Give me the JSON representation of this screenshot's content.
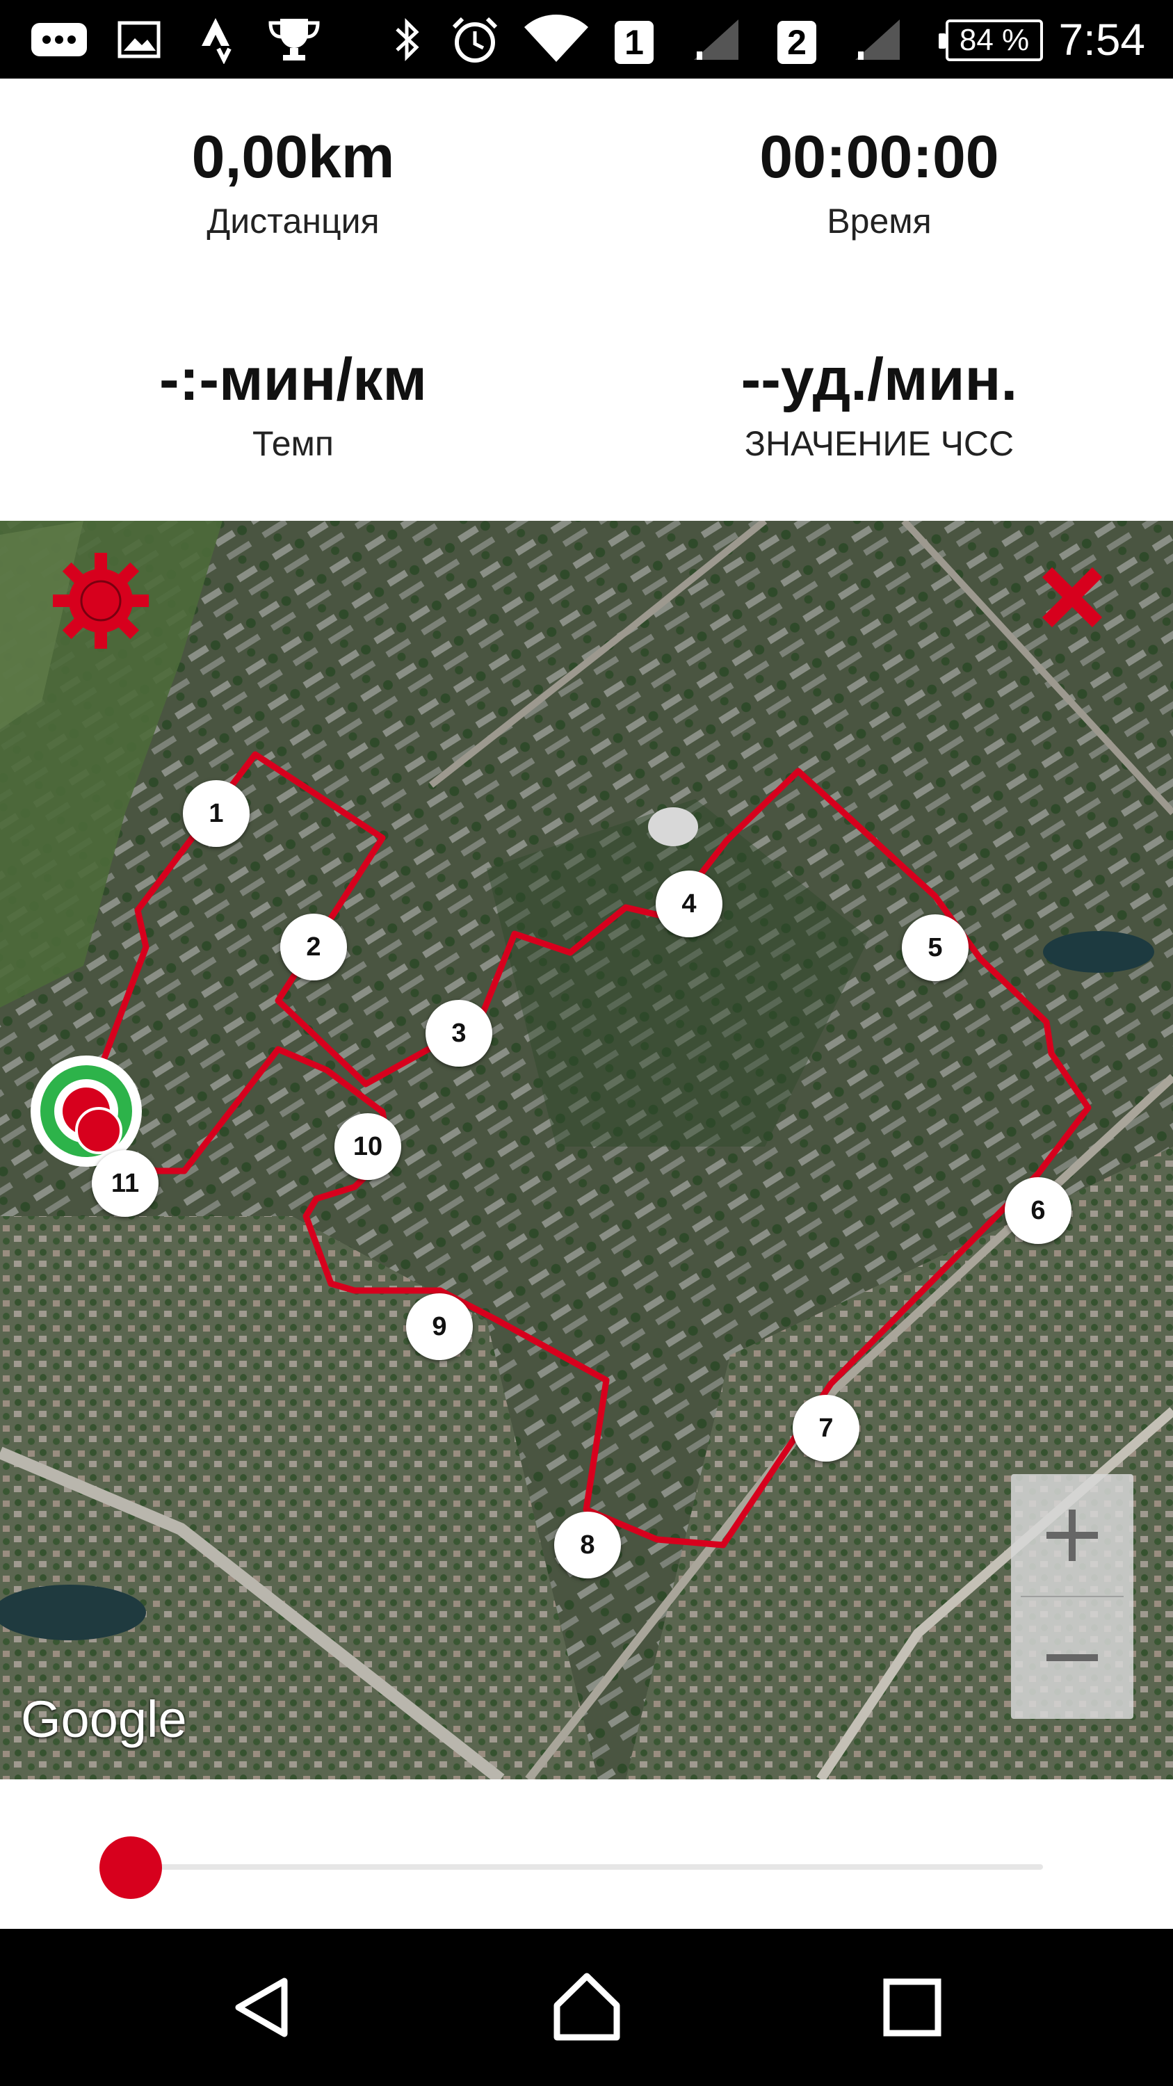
{
  "status_bar": {
    "time": "7:54",
    "battery": "84 %",
    "sim1": "1",
    "sim2": "2",
    "icons": [
      "more-notifications-icon",
      "gallery-icon",
      "strava-icon",
      "trophy-icon",
      "bluetooth-icon",
      "alarm-icon",
      "wifi-icon",
      "signal-icon",
      "battery-icon"
    ]
  },
  "stats": {
    "distance": {
      "value": "0,00km",
      "label": "Дистанция"
    },
    "time": {
      "value": "00:00:00",
      "label": "Время"
    },
    "pace": {
      "value": "-:-мин/км",
      "label": "Темп"
    },
    "heart_rate": {
      "value": "--уд./мин.",
      "label": "ЗНАЧЕНИЕ ЧСС"
    }
  },
  "map": {
    "attribution": "Google",
    "route_color": "#d7001d",
    "markers": [
      "1",
      "2",
      "3",
      "4",
      "5",
      "6",
      "7",
      "8",
      "9",
      "10",
      "11"
    ],
    "zoom_in": "+",
    "zoom_out": "−"
  },
  "playback": {
    "progress": 0
  },
  "colors": {
    "accent": "#d7001d",
    "start_marker": "#2db34a"
  }
}
